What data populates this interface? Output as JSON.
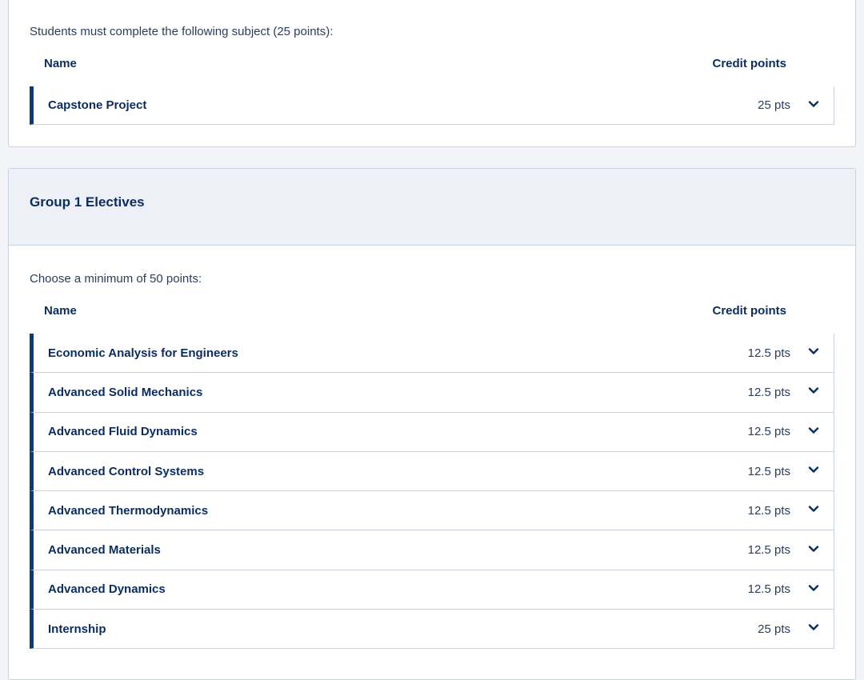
{
  "core": {
    "intro": "Students must complete the following subject (25 points):",
    "col_name": "Name",
    "col_credits": "Credit points",
    "rows": [
      {
        "name": "Capstone Project",
        "points": "25 pts"
      }
    ]
  },
  "group1": {
    "title": "Group 1 Electives",
    "intro": "Choose a minimum of 50 points:",
    "col_name": "Name",
    "col_credits": "Credit points",
    "rows": [
      {
        "name": "Economic Analysis for Engineers",
        "points": "12.5 pts"
      },
      {
        "name": "Advanced Solid Mechanics",
        "points": "12.5 pts"
      },
      {
        "name": "Advanced Fluid Dynamics",
        "points": "12.5 pts"
      },
      {
        "name": "Advanced Control Systems",
        "points": "12.5 pts"
      },
      {
        "name": "Advanced Thermodynamics",
        "points": "12.5 pts"
      },
      {
        "name": "Advanced Materials",
        "points": "12.5 pts"
      },
      {
        "name": "Advanced Dynamics",
        "points": "12.5 pts"
      },
      {
        "name": "Internship",
        "points": "25 pts"
      }
    ]
  },
  "icons": {
    "expand": "chevron-down-icon"
  },
  "colors": {
    "accent": "#0a3a78",
    "text": "#0a2d5e",
    "header_bg": "#edf1f7",
    "border": "#c9d3e0"
  }
}
